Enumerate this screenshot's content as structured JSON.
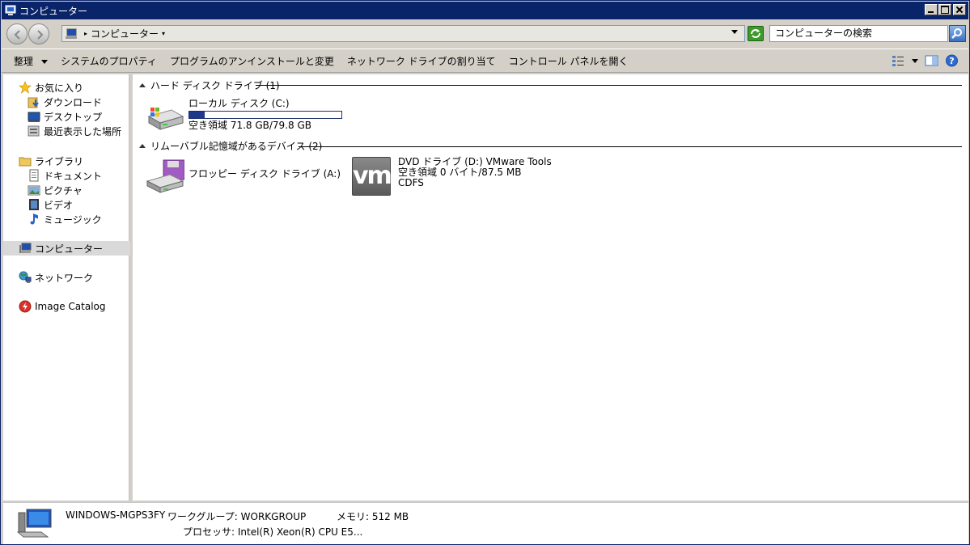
{
  "window": {
    "title": "コンピューター"
  },
  "address": {
    "crumb": "コンピューター",
    "search_placeholder": "コンピューターの検索"
  },
  "toolbar": {
    "organize": "整理",
    "items": [
      "システムのプロパティ",
      "プログラムのアンインストールと変更",
      "ネットワーク ドライブの割り当て",
      "コントロール パネルを開く"
    ]
  },
  "nav": {
    "favorites": "お気に入り",
    "downloads": "ダウンロード",
    "desktop": "デスクトップ",
    "recent": "最近表示した場所",
    "libraries": "ライブラリ",
    "documents": "ドキュメント",
    "pictures": "ピクチャ",
    "videos": "ビデオ",
    "music": "ミュージック",
    "computer": "コンピューター",
    "network": "ネットワーク",
    "image_catalog": "Image Catalog"
  },
  "groups": {
    "hdd": {
      "header": "ハード ディスク ドライブ (1)"
    },
    "removable": {
      "header": "リムーバブル記憶域があるデバイス (2)"
    }
  },
  "drives": {
    "c": {
      "name": "ローカル ディスク (C:)",
      "free": "空き領域 71.8 GB/79.8 GB",
      "used_fraction": 0.1
    },
    "a": {
      "name": "フロッピー ディスク ドライブ (A:)"
    },
    "d": {
      "name": "DVD ドライブ (D:) VMware Tools",
      "free": "空き領域 0 バイト/87.5 MB",
      "fs": "CDFS",
      "logo": "vm"
    }
  },
  "details": {
    "computer_name": "WINDOWS-MGPS3FY",
    "workgroup": "ワークグループ: WORKGROUP",
    "memory": "メモリ: 512 MB",
    "processor": "プロセッサ: Intel(R) Xeon(R) CPU E5..."
  },
  "colors": {
    "titlebar": "#0a246a",
    "capacity_fill": "#1f3a8a"
  }
}
